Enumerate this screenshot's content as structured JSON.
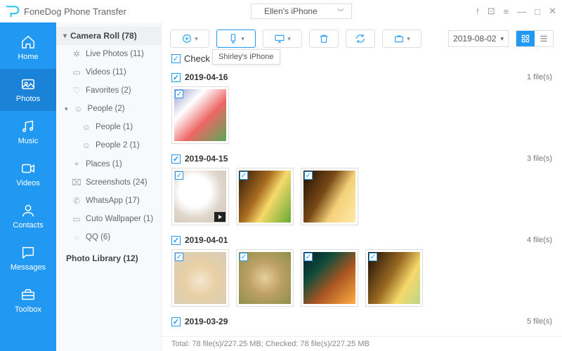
{
  "app": {
    "name": "FoneDog Phone Transfer"
  },
  "device": {
    "icon": "apple",
    "name": "Ellen's iPhone"
  },
  "windowControls": [
    "feedback",
    "help",
    "menu",
    "minimize",
    "maximize",
    "close"
  ],
  "nav": {
    "items": [
      {
        "key": "home",
        "label": "Home"
      },
      {
        "key": "photos",
        "label": "Photos",
        "active": true
      },
      {
        "key": "music",
        "label": "Music"
      },
      {
        "key": "videos",
        "label": "Videos"
      },
      {
        "key": "contacts",
        "label": "Contacts"
      },
      {
        "key": "messages",
        "label": "Messages"
      },
      {
        "key": "toolbox",
        "label": "Toolbox"
      }
    ]
  },
  "sidebar": {
    "group_label": "Camera Roll (78)",
    "items": [
      {
        "icon": "✲",
        "label": "Live Photos (11)"
      },
      {
        "icon": "▭",
        "label": "Videos (11)"
      },
      {
        "icon": "♡",
        "label": "Favorites (2)"
      },
      {
        "icon": "☺",
        "label": "People (2)",
        "expandable": true,
        "expanded": true
      },
      {
        "icon": "☺",
        "label": "People (1)",
        "indent": true
      },
      {
        "icon": "☺",
        "label": "People 2 (1)",
        "indent": true
      },
      {
        "icon": "⌖",
        "label": "Places (1)"
      },
      {
        "icon": "⌧",
        "label": "Screenshots (24)"
      },
      {
        "icon": "✆",
        "label": "WhatsApp (17)"
      },
      {
        "icon": "▭",
        "label": "Cuto Wallpaper (1)"
      },
      {
        "icon": "◌",
        "label": "QQ (6)"
      }
    ],
    "library_label": "Photo Library (12)"
  },
  "toolbar": {
    "add": "add",
    "transfer": "transfer",
    "export": "export",
    "delete": "delete",
    "refresh": "refresh",
    "dedupe": "toolbox",
    "tooltip": "Shirley's iPhone",
    "date": "2019-08-02",
    "view": "grid"
  },
  "checkall_label": "Check All(78)",
  "groups": [
    {
      "date": "2019-04-16",
      "count_label": "1 file(s)",
      "thumbs": [
        {
          "cls": "ph-phone"
        }
      ]
    },
    {
      "date": "2019-04-15",
      "count_label": "3 file(s)",
      "thumbs": [
        {
          "cls": "ph-mug",
          "video": true
        },
        {
          "cls": "ph-beer"
        },
        {
          "cls": "ph-salt"
        }
      ]
    },
    {
      "date": "2019-04-01",
      "count_label": "4 file(s)",
      "thumbs": [
        {
          "cls": "ph-pup1"
        },
        {
          "cls": "ph-pup2"
        },
        {
          "cls": "ph-neon"
        },
        {
          "cls": "ph-beer2"
        }
      ]
    },
    {
      "date": "2019-03-29",
      "count_label": "5 file(s)",
      "thumbs": []
    }
  ],
  "footer": "Total: 78 file(s)/227.25 MB; Checked: 78 file(s)/227.25 MB"
}
